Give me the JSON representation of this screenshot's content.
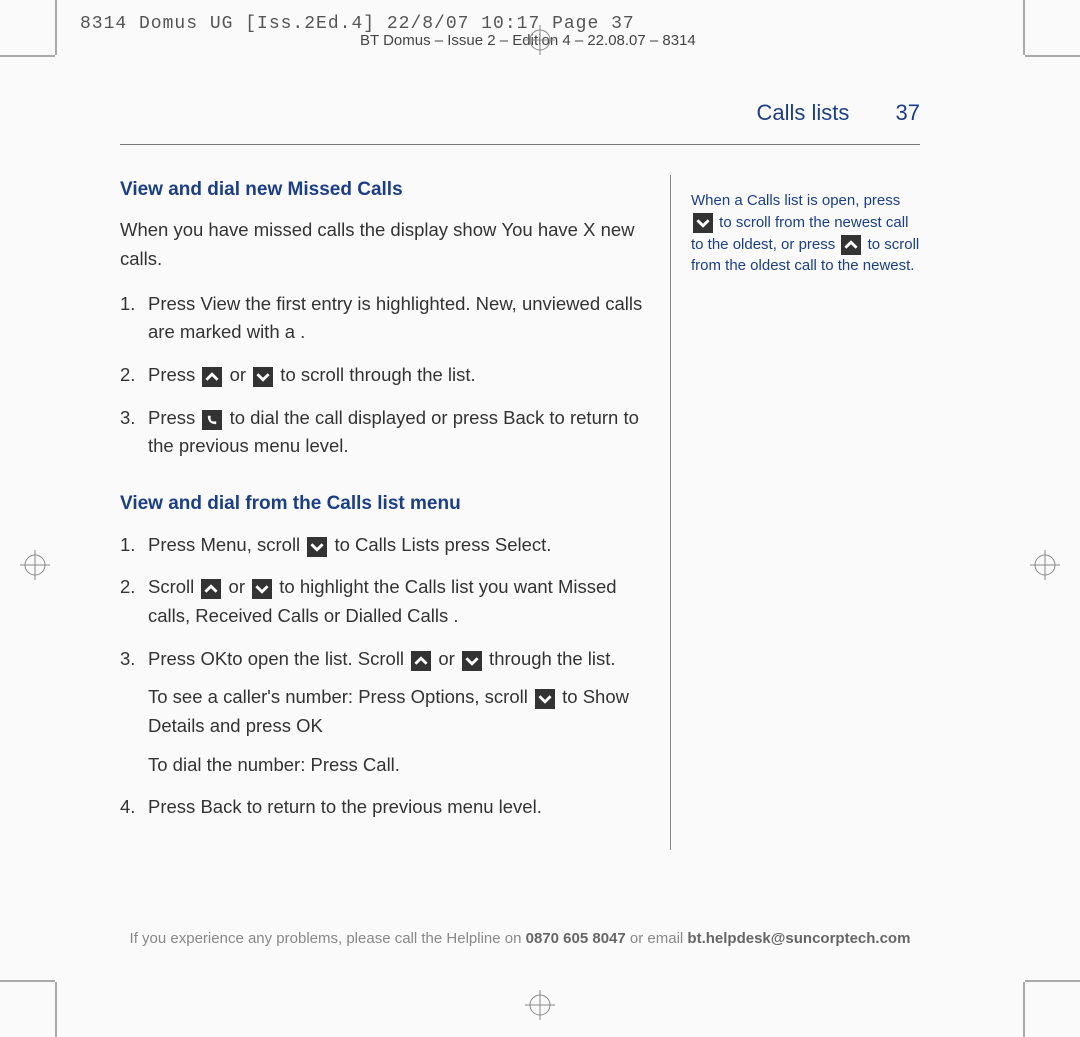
{
  "print_header": "8314 Domus UG [Iss.2Ed.4]  22/8/07  10:17  Page 37",
  "doc_id": "BT Domus – Issue 2 – Edition 4 – 22.08.07 – 8314",
  "header": {
    "section": "Calls lists",
    "page_number": "37"
  },
  "main": {
    "h1": "View and dial new Missed Calls",
    "intro_a": "When you have missed calls the display show ",
    "intro_b": "You have X new calls",
    "intro_c": ".",
    "list1": {
      "i1_a": "Press ",
      "i1_b": "View ",
      "i1_c": "the first entry is highlighted. New, unviewed calls are marked with a   .",
      "i2_a": "Press ",
      "i2_b": " or ",
      "i2_c": " to scroll through the list.",
      "i3_a": "Press ",
      "i3_b": " to dial the call displayed or press ",
      "i3_c": "Back",
      "i3_d": " to return to the previous menu level."
    },
    "h2": "View and dial from the Calls list menu",
    "list2": {
      "i1_a": "Press ",
      "i1_b": "Menu",
      "i1_c": ", scroll ",
      "i1_d": " to ",
      "i1_e": "Calls Lists",
      "i1_f": "    press ",
      "i1_g": "Select",
      "i1_h": ".",
      "i2_a": "Scroll ",
      "i2_b": " or ",
      "i2_c": " to highlight the Calls list you want ",
      "i2_d": "Missed calls",
      "i2_e": ", ",
      "i2_f": "Received Calls",
      "i2_g": "   or ",
      "i2_h": "Dialled Calls",
      "i2_i": "   .",
      "i3_a": "Press ",
      "i3_b": "OK",
      "i3_c": "to open the list. Scroll ",
      "i3_d": " or ",
      "i3_e": " through the list.",
      "i3_sub1_a": "To see a caller's number: Press ",
      "i3_sub1_b": "Options",
      "i3_sub1_c": ", scroll ",
      "i3_sub1_d": " to ",
      "i3_sub1_e": "Show Details",
      "i3_sub1_f": "   and press ",
      "i3_sub1_g": "OK",
      "i3_sub2_a": "To dial the number: Press ",
      "i3_sub2_b": "Call",
      "i3_sub2_c": ".",
      "i4_a": "Press ",
      "i4_b": "Back",
      "i4_c": " to return to the previous menu level."
    }
  },
  "side": {
    "t1": "When a Calls list is open, press ",
    "t2": " to scroll from the newest call to the oldest, or press ",
    "t3": " to scroll from the oldest call to the newest."
  },
  "footer": {
    "a": "If you experience any problems, please call the Helpline on ",
    "b": "0870 605 8047",
    "c": " or email ",
    "d": "bt.helpdesk@suncorptech.com"
  },
  "nums": {
    "n1": "1.",
    "n2": "2.",
    "n3": "3.",
    "n4": "4."
  }
}
